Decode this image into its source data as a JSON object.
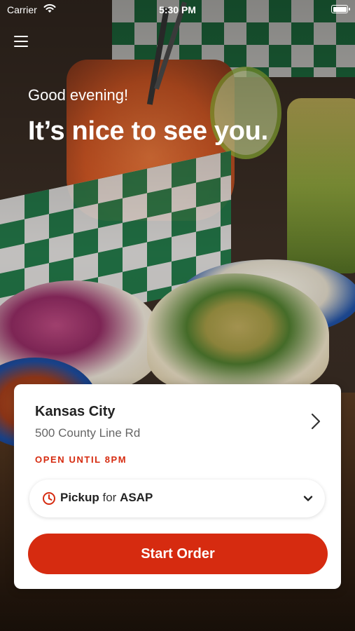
{
  "status_bar": {
    "carrier": "Carrier",
    "time": "5:30 PM",
    "wifi_icon": "wifi-icon",
    "battery_icon": "battery-icon"
  },
  "header": {
    "menu_icon": "hamburger-menu-icon"
  },
  "hero": {
    "greeting": "Good evening!",
    "headline": "It’s nice to see you."
  },
  "location_card": {
    "name": "Kansas City",
    "address": "500 County Line Rd",
    "status": "OPEN UNTIL 8PM",
    "status_color": "#d62b10",
    "chevron_icon": "chevron-right-icon"
  },
  "order_mode": {
    "clock_icon": "clock-icon",
    "mode": "Pickup",
    "connector": "for",
    "time": "ASAP",
    "dropdown_icon": "chevron-down-icon"
  },
  "actions": {
    "start_order_label": "Start Order",
    "accent_color": "#d62b10"
  }
}
